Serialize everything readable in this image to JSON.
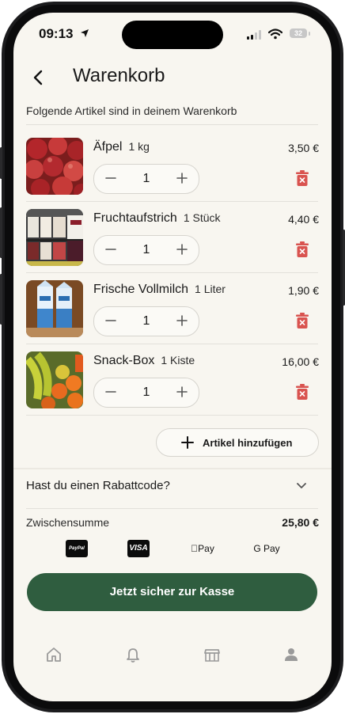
{
  "status_bar": {
    "time": "09:13",
    "battery": "32"
  },
  "header": {
    "title": "Warenkorb"
  },
  "cart": {
    "subtitle": "Folgende Artikel sind in deinem Warenkorb",
    "items": [
      {
        "name": "Äfpel",
        "unit": "1 kg",
        "price": "3,50 €",
        "quantity": "1"
      },
      {
        "name": "Fruchtaufstrich",
        "unit": "1 Stück",
        "price": "4,40 €",
        "quantity": "1"
      },
      {
        "name": "Frische Vollmilch",
        "unit": "1 Liter",
        "price": "1,90 €",
        "quantity": "1"
      },
      {
        "name": "Snack-Box",
        "unit": "1 Kiste",
        "price": "16,00 €",
        "quantity": "1"
      }
    ],
    "add_label": "Artikel hinzufügen"
  },
  "discount": {
    "label": "Hast du einen Rabattcode?"
  },
  "summary": {
    "label": "Zwischensumme",
    "value": "25,80 €"
  },
  "payment_methods": [
    "PayPal",
    "VISA",
    "Pay",
    "G Pay"
  ],
  "checkout": {
    "label": "Jetzt sicher zur Kasse",
    "color": "#2f5d3f"
  },
  "tabbar": {
    "icons": [
      "home-icon",
      "bell-icon",
      "store-icon",
      "user-icon"
    ]
  },
  "colors": {
    "accent": "#2f5d3f",
    "delete": "#d9534f",
    "background": "#f8f6f0"
  }
}
